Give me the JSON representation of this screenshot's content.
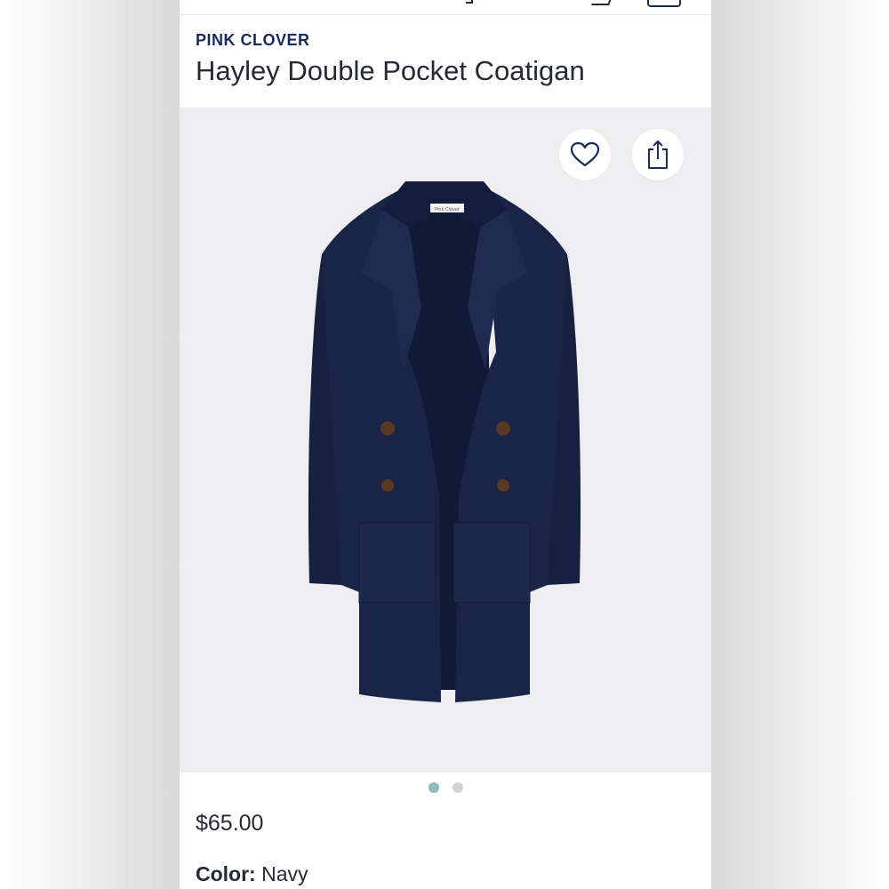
{
  "product": {
    "brand": "PINK CLOVER",
    "title": "Hayley Double Pocket Coatigan",
    "price": "$65.00",
    "color_label": "Color:",
    "color_value": "Navy",
    "garment_tag": "Pink Clover"
  },
  "actions": {
    "favorite_icon": "heart-icon",
    "share_icon": "share-icon"
  },
  "carousel": {
    "total": 2,
    "active_index": 0
  },
  "colors": {
    "brand": "#1b2a5c",
    "text": "#262a33",
    "image_bg": "#eeeef0",
    "coat": "#1a2446",
    "dot_active": "#8fb9ba",
    "dot_inactive": "#d3d3d5"
  }
}
